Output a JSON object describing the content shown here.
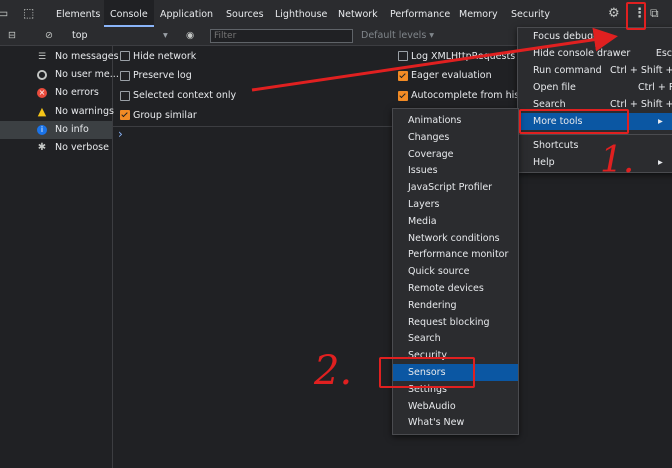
{
  "tabs": [
    {
      "label": "Elements",
      "active": false
    },
    {
      "label": "Console",
      "active": true
    },
    {
      "label": "Application",
      "active": false
    },
    {
      "label": "Sources",
      "active": false
    },
    {
      "label": "Lighthouse",
      "active": false
    },
    {
      "label": "Network",
      "active": false
    },
    {
      "label": "Performance",
      "active": false
    },
    {
      "label": "Memory",
      "active": false
    },
    {
      "label": "Security",
      "active": false
    }
  ],
  "toolbar": {
    "context": "top",
    "filter_placeholder": "Filter",
    "levels_label": "Default levels ▾"
  },
  "sidebar": {
    "items": [
      {
        "label": "No messages",
        "icon": "list-icon"
      },
      {
        "label": "No user me...",
        "icon": "user-icon"
      },
      {
        "label": "No errors",
        "icon": "error-icon"
      },
      {
        "label": "No warnings",
        "icon": "warning-icon"
      },
      {
        "label": "No info",
        "icon": "info-icon",
        "selected": true
      },
      {
        "label": "No verbose",
        "icon": "bug-icon"
      }
    ]
  },
  "settings": {
    "left": [
      {
        "label": "Hide network",
        "checked": false
      },
      {
        "label": "Preserve log",
        "checked": false
      },
      {
        "label": "Selected context only",
        "checked": false
      },
      {
        "label": "Group similar",
        "checked": true
      }
    ],
    "right": [
      {
        "label": "Log XMLHttpRequests",
        "checked": false
      },
      {
        "label": "Eager evaluation",
        "checked": true
      },
      {
        "label": "Autocomplete from history",
        "checked": true
      }
    ]
  },
  "prompt": "›",
  "main_menu": {
    "items": [
      {
        "label": "Focus debuggee",
        "shortcut": ""
      },
      {
        "label": "Hide console drawer",
        "shortcut": "Esc"
      },
      {
        "label": "Run command",
        "shortcut": "Ctrl + Shift + P"
      },
      {
        "label": "Open file",
        "shortcut": "Ctrl + P"
      },
      {
        "label": "Search",
        "shortcut": "Ctrl + Shift + F"
      },
      {
        "label": "More tools",
        "shortcut": "▸"
      },
      {
        "label": "Shortcuts",
        "shortcut": ""
      },
      {
        "label": "Help",
        "shortcut": "▸"
      }
    ]
  },
  "tools_menu": {
    "items": [
      "Animations",
      "Changes",
      "Coverage",
      "Issues",
      "JavaScript Profiler",
      "Layers",
      "Media",
      "Network conditions",
      "Performance monitor",
      "Quick source",
      "Remote devices",
      "Rendering",
      "Request blocking",
      "Search",
      "Security",
      "Sensors",
      "Settings",
      "WebAudio",
      "What's New"
    ],
    "highlighted": "Sensors"
  },
  "annotations": {
    "step1": "1.",
    "step2": "2."
  },
  "colors": {
    "accent": "#8ab4f8",
    "highlight": "#0b57a3",
    "annotation": "#e02020",
    "checkbox": "#f28b25"
  }
}
